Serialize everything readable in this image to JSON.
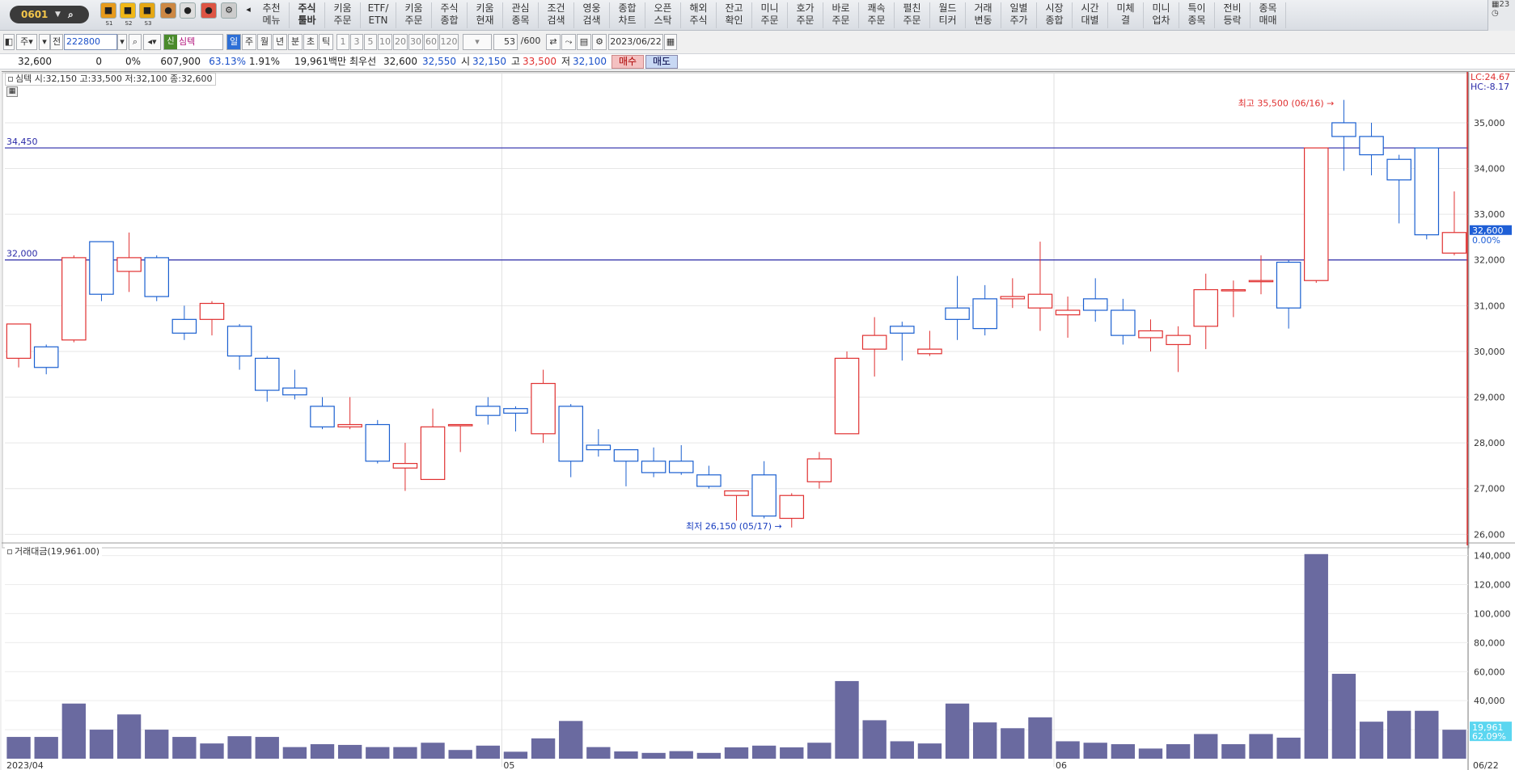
{
  "window": {
    "account_code": "0601"
  },
  "quick_tools": [
    {
      "name": "save-icon",
      "label": "S1",
      "color": "#e79b1d"
    },
    {
      "name": "brush-icon",
      "label": "S2",
      "color": "#f1b817"
    },
    {
      "name": "lock-icon",
      "label": "S3",
      "color": "#e6a713"
    }
  ],
  "menu": [
    {
      "label": "추천\n메뉴"
    },
    {
      "label": "주식\n툴바"
    },
    {
      "label": "키움\n주문"
    },
    {
      "label": "ETF/\nETN"
    },
    {
      "label": "키움\n주문"
    },
    {
      "label": "주식\n종합"
    },
    {
      "label": "키움\n현재"
    },
    {
      "label": "관심\n종목"
    },
    {
      "label": "조건\n검색"
    },
    {
      "label": "영웅\n검색"
    },
    {
      "label": "종합\n차트"
    },
    {
      "label": "오픈\n스탁"
    },
    {
      "label": "해외\n주식"
    },
    {
      "label": "잔고\n확인"
    },
    {
      "label": "미니\n주문"
    },
    {
      "label": "호가\n주문"
    },
    {
      "label": "바로\n주문"
    },
    {
      "label": "쾌속\n주문"
    },
    {
      "label": "펼친\n주문"
    },
    {
      "label": "월드\n티커"
    },
    {
      "label": "거래\n변동"
    },
    {
      "label": "일별\n주가"
    },
    {
      "label": "시장\n종합"
    },
    {
      "label": "시간\n대별"
    },
    {
      "label": "미체\n결"
    },
    {
      "label": "미니\n업차"
    },
    {
      "label": "특이\n종목"
    },
    {
      "label": "전비\n등락"
    },
    {
      "label": "종목\n매매"
    }
  ],
  "top_right": {
    "top": "23",
    "bottom": "◷"
  },
  "toolbar": {
    "market": "주",
    "scope": "전",
    "stock_code": "222800",
    "stock_name": "심텍",
    "new_badge": "신",
    "periods": [
      "일",
      "주",
      "월",
      "년",
      "분",
      "초",
      "틱"
    ],
    "intervals": [
      "1",
      "3",
      "5",
      "10",
      "20",
      "30",
      "60",
      "120"
    ],
    "count": "53",
    "max_count": "/600",
    "date": "2023/06/22"
  },
  "quote": {
    "price": "32,600",
    "change": "0",
    "change_pct": "0%",
    "volume": "607,900",
    "vol_ratio": "63.13%",
    "turnover": "1.91%",
    "amount": "19,961백만",
    "best_label": "최우선",
    "best_ask": "32,600",
    "best_bid": "32,550",
    "open_label": "시",
    "open": "32,150",
    "high_label": "고",
    "high": "33,500",
    "low_label": "저",
    "low": "32,100",
    "buy": "매수",
    "sell": "매도"
  },
  "chart_data": {
    "type": "candlestick",
    "title": "심텍 시:32,150 고:33,500 저:32,100 종:32,600",
    "volume_title": "거래대금(19,961.00)",
    "x_ticks": [
      "2023/04",
      "05",
      "06",
      "06/22"
    ],
    "price_ylim": [
      25900,
      35900
    ],
    "price_ticks": [
      26000,
      27000,
      28000,
      29000,
      30000,
      31000,
      32000,
      33000,
      34000,
      35000
    ],
    "price_tick_labels": [
      "26,000",
      "27,000",
      "28,000",
      "29,000",
      "30,000",
      "31,000",
      "32,000",
      "33,000",
      "34,000",
      "35,000"
    ],
    "volume_ylim": [
      0,
      142000
    ],
    "volume_ticks": [
      20000,
      40000,
      60000,
      80000,
      100000,
      120000,
      140000
    ],
    "volume_tick_labels": [
      "20,000",
      "40,000",
      "60,000",
      "80,000",
      "100,000",
      "120,000",
      "140,000"
    ],
    "hlines": [
      {
        "value": 34450,
        "label": "34,450"
      },
      {
        "value": 32000,
        "label": "32,000"
      }
    ],
    "high_annotation": "최고 35,500 (06/16) →",
    "low_annotation": "최저 26,150 (05/17) →",
    "right_top_labels": [
      "LC:24.67",
      "HC:-8.17"
    ],
    "last_price_label": "32,600",
    "last_change_label": "0.00%",
    "last_volume_label": "19,961",
    "last_volume_pct_label": "62.09%",
    "up_color": "#e03030",
    "down_color": "#1a5fd0",
    "volume_color": "#6a6aa0",
    "candles": [
      {
        "o": 29850,
        "h": 30200,
        "l": 29650,
        "c": 30600
      },
      {
        "o": 30100,
        "h": 30150,
        "l": 29500,
        "c": 29650
      },
      {
        "o": 30250,
        "h": 32100,
        "l": 30200,
        "c": 32050
      },
      {
        "o": 32400,
        "h": 32400,
        "l": 31100,
        "c": 31250
      },
      {
        "o": 31750,
        "h": 32600,
        "l": 31300,
        "c": 32050
      },
      {
        "o": 32050,
        "h": 32100,
        "l": 31100,
        "c": 31200
      },
      {
        "o": 30700,
        "h": 31000,
        "l": 30250,
        "c": 30400
      },
      {
        "o": 30700,
        "h": 31100,
        "l": 30350,
        "c": 31050
      },
      {
        "o": 30550,
        "h": 30600,
        "l": 29600,
        "c": 29900
      },
      {
        "o": 29850,
        "h": 29900,
        "l": 28900,
        "c": 29150
      },
      {
        "o": 29200,
        "h": 29600,
        "l": 28950,
        "c": 29050
      },
      {
        "o": 28800,
        "h": 29000,
        "l": 28300,
        "c": 28350
      },
      {
        "o": 28350,
        "h": 29000,
        "l": 28300,
        "c": 28400
      },
      {
        "o": 28400,
        "h": 28500,
        "l": 27550,
        "c": 27600
      },
      {
        "o": 27450,
        "h": 28000,
        "l": 26950,
        "c": 27550
      },
      {
        "o": 27200,
        "h": 28750,
        "l": 27200,
        "c": 28350
      },
      {
        "o": 28400,
        "h": 28400,
        "l": 27800,
        "c": 28400
      },
      {
        "o": 28800,
        "h": 29000,
        "l": 28400,
        "c": 28600
      },
      {
        "o": 28750,
        "h": 28800,
        "l": 28250,
        "c": 28650
      },
      {
        "o": 28200,
        "h": 29600,
        "l": 28000,
        "c": 29300
      },
      {
        "o": 28800,
        "h": 28850,
        "l": 27250,
        "c": 27600
      },
      {
        "o": 27950,
        "h": 28300,
        "l": 27700,
        "c": 27850
      },
      {
        "o": 27850,
        "h": 27850,
        "l": 27050,
        "c": 27600
      },
      {
        "o": 27600,
        "h": 27900,
        "l": 27250,
        "c": 27350
      },
      {
        "o": 27600,
        "h": 27950,
        "l": 27300,
        "c": 27350
      },
      {
        "o": 27300,
        "h": 27500,
        "l": 27000,
        "c": 27050
      },
      {
        "o": 26850,
        "h": 26950,
        "l": 26300,
        "c": 26950
      },
      {
        "o": 27300,
        "h": 27600,
        "l": 26350,
        "c": 26400
      },
      {
        "o": 26350,
        "h": 26900,
        "l": 26150,
        "c": 26850
      },
      {
        "o": 27150,
        "h": 27800,
        "l": 27000,
        "c": 27650
      },
      {
        "o": 28200,
        "h": 30000,
        "l": 28200,
        "c": 29850
      },
      {
        "o": 30050,
        "h": 30750,
        "l": 29450,
        "c": 30350
      },
      {
        "o": 30550,
        "h": 30650,
        "l": 29800,
        "c": 30400
      },
      {
        "o": 29950,
        "h": 30450,
        "l": 29900,
        "c": 30050
      },
      {
        "o": 30950,
        "h": 31650,
        "l": 30250,
        "c": 30700
      },
      {
        "o": 31150,
        "h": 31450,
        "l": 30350,
        "c": 30500
      },
      {
        "o": 31150,
        "h": 31600,
        "l": 30950,
        "c": 31200
      },
      {
        "o": 30950,
        "h": 32400,
        "l": 30450,
        "c": 31250
      },
      {
        "o": 30800,
        "h": 31200,
        "l": 30300,
        "c": 30900
      },
      {
        "o": 31150,
        "h": 31600,
        "l": 30650,
        "c": 30900
      },
      {
        "o": 30900,
        "h": 31150,
        "l": 30150,
        "c": 30350
      },
      {
        "o": 30300,
        "h": 30700,
        "l": 30000,
        "c": 30450
      },
      {
        "o": 30150,
        "h": 30550,
        "l": 29550,
        "c": 30350
      },
      {
        "o": 30550,
        "h": 31700,
        "l": 30050,
        "c": 31350
      },
      {
        "o": 31350,
        "h": 31550,
        "l": 30750,
        "c": 31350
      },
      {
        "o": 31550,
        "h": 32100,
        "l": 31250,
        "c": 31550
      },
      {
        "o": 31950,
        "h": 32000,
        "l": 30500,
        "c": 30950
      },
      {
        "o": 31550,
        "h": 34450,
        "l": 31500,
        "c": 34450
      },
      {
        "o": 35000,
        "h": 35500,
        "l": 33950,
        "c": 34700
      },
      {
        "o": 34700,
        "h": 35000,
        "l": 33850,
        "c": 34300
      },
      {
        "o": 34200,
        "h": 34300,
        "l": 32800,
        "c": 33750
      },
      {
        "o": 34450,
        "h": 34450,
        "l": 32450,
        "c": 32550
      },
      {
        "o": 32150,
        "h": 33500,
        "l": 32100,
        "c": 32600
      }
    ],
    "volumes": [
      15000,
      15000,
      38000,
      20000,
      30500,
      20000,
      15000,
      10500,
      15500,
      15000,
      8000,
      10000,
      9500,
      8000,
      8000,
      11000,
      6000,
      9000,
      4800,
      14000,
      26000,
      8000,
      5000,
      4000,
      5200,
      4000,
      7800,
      9000,
      7800,
      11000,
      53500,
      26500,
      12000,
      10500,
      38000,
      25000,
      21000,
      28500,
      12000,
      11000,
      10000,
      7000,
      10000,
      17000,
      10000,
      17000,
      14500,
      141000,
      58500,
      25500,
      33000,
      33000,
      19961
    ]
  }
}
